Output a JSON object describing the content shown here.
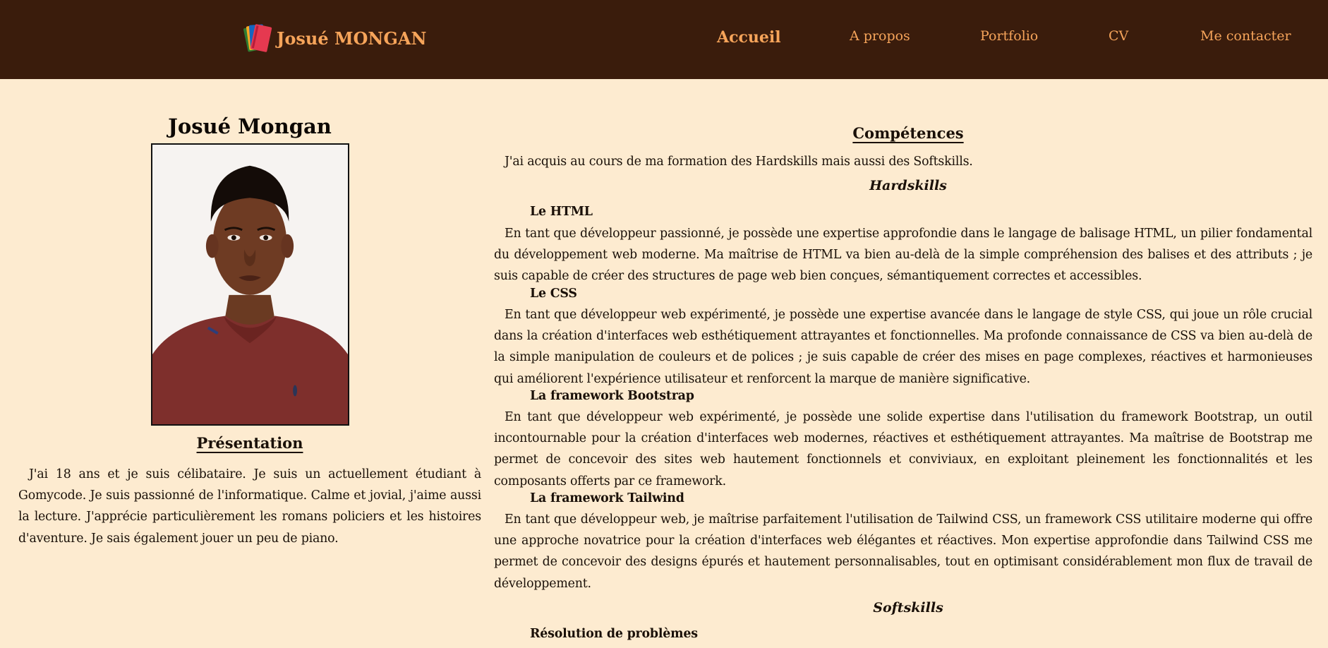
{
  "header": {
    "brand_name": "Josué MONGAN",
    "logo_icon": "stack-of-books-icon",
    "nav": {
      "home": "Accueil",
      "about": "A propos",
      "portfolio": "Portfolio",
      "cv": "CV",
      "contact": "Me contacter"
    },
    "active": "Accueil"
  },
  "profile": {
    "name": "Josué Mongan",
    "photo": "portrait-photo",
    "presentation_heading": "Présentation",
    "presentation_text": "J'ai 18 ans et je suis célibataire. Je suis un actuellement étudiant à Gomycode. Je suis passionné de l'informatique. Calme et jovial, j'aime aussi la lecture. J'apprécie particulièrement les romans policiers et les histoires d'aventure. Je sais également jouer un peu de piano."
  },
  "competences": {
    "heading": "Compétences",
    "intro": "J'ai acquis au cours de ma formation des Hardskills mais aussi des Softskills.",
    "hardskills_heading": "Hardskills",
    "skills": [
      {
        "title": "Le HTML",
        "text": "En tant que développeur passionné, je possède une expertise approfondie dans le langage de balisage HTML, un pilier fondamental du développement web moderne. Ma maîtrise de HTML va bien au-delà de la simple compréhension des balises et des attributs ; je suis capable de créer des structures de page web bien conçues, sémantiquement correctes et accessibles."
      },
      {
        "title": "Le CSS",
        "text": "En tant que développeur web expérimenté, je possède une expertise avancée dans le langage de style CSS, qui joue un rôle crucial dans la création d'interfaces web esthétiquement attrayantes et fonctionnelles. Ma profonde connaissance de CSS va bien au-delà de la simple manipulation de couleurs et de polices ; je suis capable de créer des mises en page complexes, réactives et harmonieuses qui améliorent l'expérience utilisateur et renforcent la marque de manière significative."
      },
      {
        "title": "La framework Bootstrap",
        "text": "En tant que développeur web expérimenté, je possède une solide expertise dans l'utilisation du framework Bootstrap, un outil incontournable pour la création d'interfaces web modernes, réactives et esthétiquement attrayantes. Ma maîtrise de Bootstrap me permet de concevoir des sites web hautement fonctionnels et conviviaux, en exploitant pleinement les fonctionnalités et les composants offerts par ce framework."
      },
      {
        "title": "La framework Tailwind",
        "text": "En tant que développeur web, je maîtrise parfaitement l'utilisation de Tailwind CSS, un framework CSS utilitaire moderne qui offre une approche novatrice pour la création d'interfaces web élégantes et réactives. Mon expertise approfondie dans Tailwind CSS me permet de concevoir des designs épurés et hautement personnalisables, tout en optimisant considérablement mon flux de travail de développement."
      }
    ],
    "softskills_heading": "Softskills",
    "soft_first_title": "Résolution de problèmes"
  },
  "colors": {
    "navbar_bg": "#3a1c0c",
    "nav_text": "#f6a45a",
    "page_bg": "#fdebd0"
  }
}
